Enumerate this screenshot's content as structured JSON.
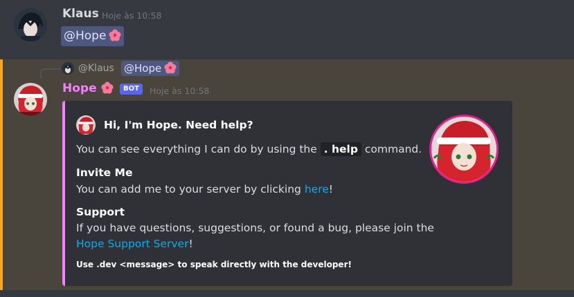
{
  "message1": {
    "author": "Klaus",
    "timestamp": "Hoje às 10:58",
    "mention": "@Hope"
  },
  "message2": {
    "reply": {
      "author": "@Klaus",
      "mention": "@Hope"
    },
    "author": "Hope",
    "badge": "BOT",
    "timestamp": "Hoje às 10:58",
    "embed": {
      "title": "Hi, I'm Hope. Need help?",
      "line1_pre": "You can see everything I can do by using the",
      "line1_code": ". help",
      "line1_post": "command.",
      "section1_title": "Invite Me",
      "section1_pre": "You can add me to your server by clicking",
      "section1_link": "here",
      "section1_post": "!",
      "section2_title": "Support",
      "section2_line": "If you have questions, suggestions, or found a bug, please join the",
      "section2_link": "Hope Support Server",
      "section2_post": "!",
      "footer": "Use .dev <message> to speak directly with the developer!"
    }
  },
  "colors": {
    "highlight_bar": "#faa61a",
    "bot_name": "#f47fff",
    "embed_accent": "#f47fff",
    "link": "#00aff4",
    "bot_badge": "#5865f2"
  },
  "icons": [
    "hibiscus-emoji",
    "avatar-klaus",
    "avatar-hope"
  ]
}
